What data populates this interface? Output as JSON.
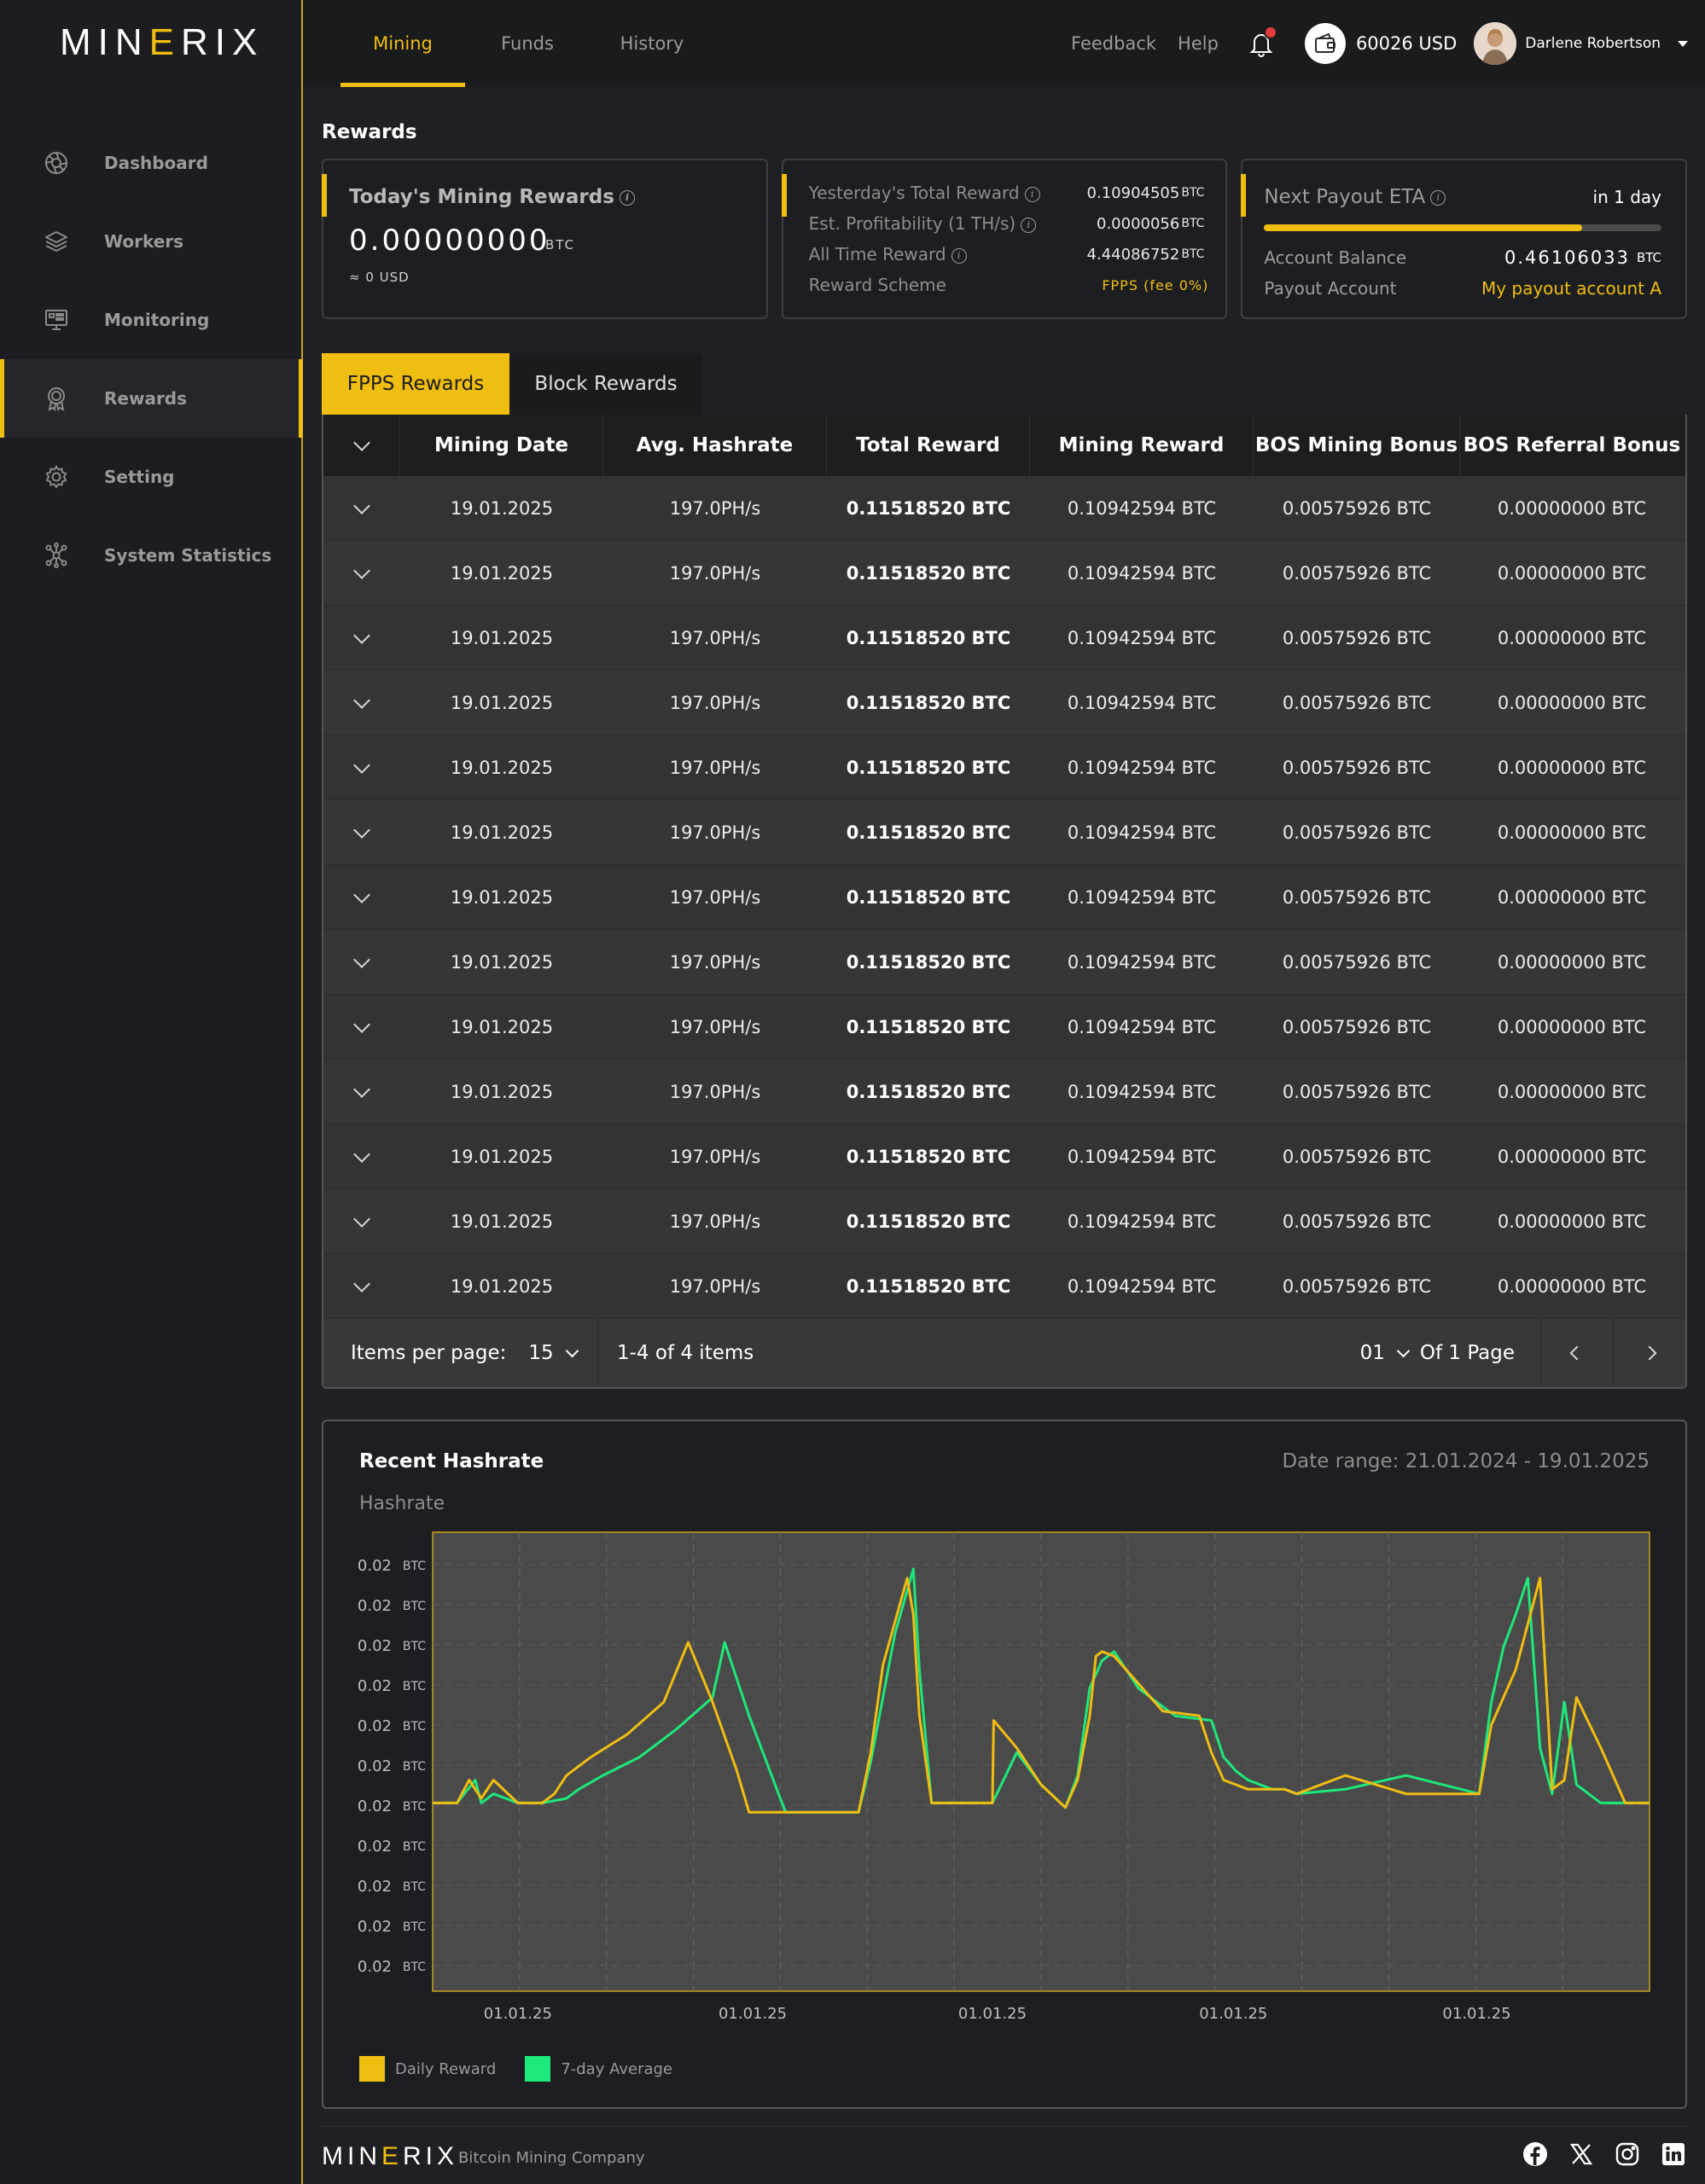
{
  "brand": {
    "logo_text_a": "MIN",
    "logo_text_b": "E",
    "logo_text_c": "RIX",
    "tagline": "Bitcoin Mining Company"
  },
  "sidebar": {
    "items": [
      {
        "label": "Dashboard",
        "icon": "dashboard-icon"
      },
      {
        "label": "Workers",
        "icon": "layers-icon"
      },
      {
        "label": "Monitoring",
        "icon": "monitor-icon"
      },
      {
        "label": "Rewards",
        "icon": "award-icon",
        "active": true
      },
      {
        "label": "Setting",
        "icon": "gear-icon"
      },
      {
        "label": "System Statistics",
        "icon": "network-icon"
      }
    ]
  },
  "header": {
    "tabs": [
      "Mining",
      "Funds",
      "History"
    ],
    "active_tab": "Mining",
    "feedback": "Feedback",
    "help": "Help",
    "balance": "60026 USD",
    "user_name": "Darlene Robertson"
  },
  "page": {
    "title": "Rewards"
  },
  "cards": {
    "today": {
      "title": "Today's Mining Rewards",
      "amount": "0.00000000",
      "unit": "BTC",
      "usd": "≈ 0 USD"
    },
    "stats": [
      {
        "label": "Yesterday's Total Reward",
        "value": "0.10904505",
        "unit": "BTC",
        "info": true
      },
      {
        "label": "Est. Profitability (1 TH/s)",
        "value": "0.0000056",
        "unit": "BTC",
        "info": true
      },
      {
        "label": "All Time Reward",
        "value": "4.44086752",
        "unit": "BTC",
        "info": true
      },
      {
        "label": "Reward Scheme",
        "value": "FPPS (fee 0%)",
        "unit": "",
        "info": false
      }
    ],
    "payout": {
      "title": "Next Payout ETA",
      "eta": "in 1 day",
      "progress_percent": 80,
      "balance_label": "Account Balance",
      "balance_value": "0.46106033",
      "balance_unit": "BTC",
      "account_label": "Payout Account",
      "account_value": "My payout account A"
    }
  },
  "reward_tabs": [
    "FPPS Rewards",
    "Block Rewards"
  ],
  "table": {
    "headers": [
      "Mining Date",
      "Avg. Hashrate",
      "Total Reward",
      "Mining Reward",
      "BOS Mining Bonus",
      "BOS Referral Bonus"
    ],
    "rows": [
      [
        "19.01.2025",
        "197.0PH/s",
        "0.11518520 BTC",
        "0.10942594 BTC",
        "0.00575926 BTC",
        "0.00000000 BTC"
      ],
      [
        "19.01.2025",
        "197.0PH/s",
        "0.11518520 BTC",
        "0.10942594 BTC",
        "0.00575926 BTC",
        "0.00000000 BTC"
      ],
      [
        "19.01.2025",
        "197.0PH/s",
        "0.11518520 BTC",
        "0.10942594 BTC",
        "0.00575926 BTC",
        "0.00000000 BTC"
      ],
      [
        "19.01.2025",
        "197.0PH/s",
        "0.11518520 BTC",
        "0.10942594 BTC",
        "0.00575926 BTC",
        "0.00000000 BTC"
      ],
      [
        "19.01.2025",
        "197.0PH/s",
        "0.11518520 BTC",
        "0.10942594 BTC",
        "0.00575926 BTC",
        "0.00000000 BTC"
      ],
      [
        "19.01.2025",
        "197.0PH/s",
        "0.11518520 BTC",
        "0.10942594 BTC",
        "0.00575926 BTC",
        "0.00000000 BTC"
      ],
      [
        "19.01.2025",
        "197.0PH/s",
        "0.11518520 BTC",
        "0.10942594 BTC",
        "0.00575926 BTC",
        "0.00000000 BTC"
      ],
      [
        "19.01.2025",
        "197.0PH/s",
        "0.11518520 BTC",
        "0.10942594 BTC",
        "0.00575926 BTC",
        "0.00000000 BTC"
      ],
      [
        "19.01.2025",
        "197.0PH/s",
        "0.11518520 BTC",
        "0.10942594 BTC",
        "0.00575926 BTC",
        "0.00000000 BTC"
      ],
      [
        "19.01.2025",
        "197.0PH/s",
        "0.11518520 BTC",
        "0.10942594 BTC",
        "0.00575926 BTC",
        "0.00000000 BTC"
      ],
      [
        "19.01.2025",
        "197.0PH/s",
        "0.11518520 BTC",
        "0.10942594 BTC",
        "0.00575926 BTC",
        "0.00000000 BTC"
      ],
      [
        "19.01.2025",
        "197.0PH/s",
        "0.11518520 BTC",
        "0.10942594 BTC",
        "0.00575926 BTC",
        "0.00000000 BTC"
      ],
      [
        "19.01.2025",
        "197.0PH/s",
        "0.11518520 BTC",
        "0.10942594 BTC",
        "0.00575926 BTC",
        "0.00000000 BTC"
      ]
    ],
    "footer": {
      "per_page_label": "Items per page:",
      "per_page_value": "15",
      "range": "1-4 of 4 items",
      "page_value": "01",
      "page_of": "Of 1 Page"
    }
  },
  "colors": {
    "accent": "#f0bd11",
    "green": "#1de87a",
    "bg": "#1f2023"
  },
  "chart_data": {
    "type": "line",
    "title": "Recent Hashrate",
    "ylabel": "Hashrate",
    "date_range": "Date range: 21.01.2024 - 19.01.2025",
    "y_tick_labels": [
      "0.02",
      "0.02",
      "0.02",
      "0.02",
      "0.02",
      "0.02",
      "0.02",
      "0.02",
      "0.02",
      "0.02",
      "0.02"
    ],
    "y_tick_unit": "BTC",
    "x_tick_labels": [
      "01.01.25",
      "01.01.25",
      "01.01.25",
      "01.01.25",
      "01.01.25"
    ],
    "ylim": [
      0,
      100
    ],
    "grid": true,
    "legend": "bottom-left",
    "series": [
      {
        "name": "Daily Reward",
        "color": "#f0bd11",
        "x": [
          0,
          2,
          3,
          4,
          5,
          7,
          9,
          10,
          10.5,
          11,
          13,
          16,
          19,
          21,
          23,
          25,
          26,
          28,
          29,
          35,
          36,
          37,
          39,
          39.5,
          40,
          41,
          46,
          46.1,
          48,
          50,
          52,
          53,
          54,
          54.5,
          55,
          56,
          58,
          60,
          63,
          64,
          64.5,
          65,
          67,
          69,
          70,
          71,
          75,
          80,
          86,
          87,
          89,
          91,
          92,
          93,
          94,
          96,
          98,
          100
        ],
        "values": [
          41,
          41,
          46,
          42,
          46,
          41,
          41,
          43,
          45,
          47,
          51,
          56,
          63,
          76,
          63,
          48,
          39,
          39,
          39,
          39,
          52,
          71,
          90,
          82,
          60,
          41,
          41,
          59,
          53,
          45,
          40,
          46,
          60,
          73,
          74,
          73,
          67,
          61,
          60,
          52,
          49,
          46,
          44,
          44,
          44,
          43,
          47,
          43,
          43,
          58,
          70,
          90,
          44,
          46,
          64,
          53,
          41,
          41
        ]
      },
      {
        "name": "7-day Average",
        "color": "#1de87a",
        "x": [
          0,
          2,
          3.5,
          4,
          5,
          7,
          9,
          11,
          12,
          14,
          17,
          20,
          23,
          24,
          26,
          29,
          35,
          36,
          38,
          39.5,
          40,
          41,
          46,
          48,
          50,
          52,
          53,
          54,
          55,
          56,
          58,
          61,
          64,
          65,
          66,
          67,
          69,
          70,
          71,
          75,
          80,
          86,
          87,
          88,
          89,
          90,
          91,
          92,
          93,
          94,
          96,
          98,
          100
        ],
        "values": [
          41,
          41,
          46,
          41,
          43,
          41,
          41,
          42,
          44,
          47,
          51,
          57,
          64,
          76,
          60,
          39,
          39,
          50,
          78,
          92,
          70,
          41,
          41,
          52,
          45,
          40,
          47,
          66,
          72,
          74,
          66,
          60,
          59,
          51,
          48,
          46,
          44,
          44,
          43,
          44,
          47,
          43,
          63,
          75,
          82,
          90,
          53,
          43,
          63,
          45,
          41,
          41,
          41
        ]
      }
    ]
  },
  "footer": {
    "socials": [
      "facebook-icon",
      "x-icon",
      "instagram-icon",
      "linkedin-icon"
    ]
  }
}
